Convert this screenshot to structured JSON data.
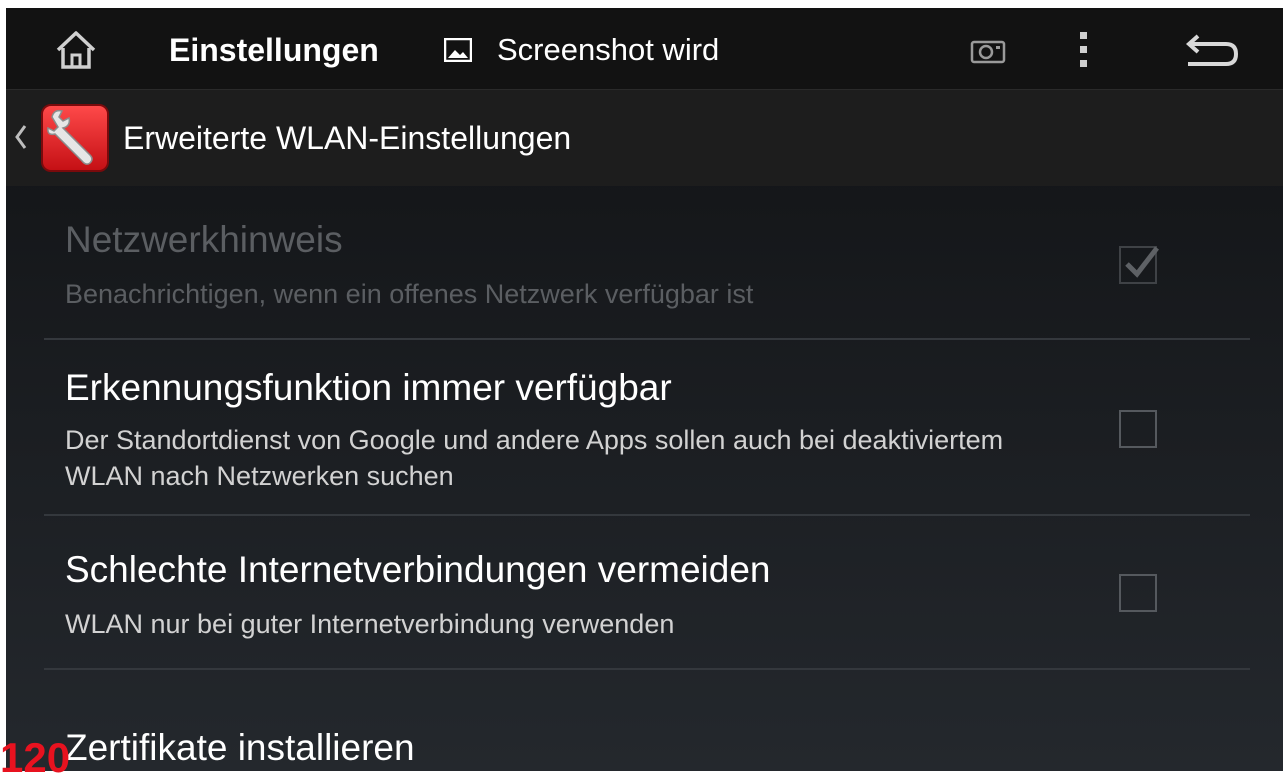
{
  "status_bar": {
    "app_title": "Einstellungen",
    "notification_text": "Screenshot wird",
    "icons": [
      "home-icon",
      "image-icon",
      "camera-icon",
      "overflow-menu-icon",
      "back-icon"
    ]
  },
  "sub_header": {
    "title": "Erweiterte WLAN-Einstellungen",
    "icons": [
      "chevron-left-icon",
      "settings-app-icon"
    ]
  },
  "preferences": [
    {
      "title": "Netzwerkhinweis",
      "summary": "Benachrichtigen, wenn ein offenes Netzwerk verfügbar ist",
      "checked": true,
      "enabled": false
    },
    {
      "title": "Erkennungsfunktion immer verfügbar",
      "summary": "Der Standortdienst von Google und andere Apps sollen auch bei deaktiviertem WLAN nach Netzwerken suchen",
      "checked": false,
      "enabled": true
    },
    {
      "title": "Schlechte Internetverbindungen vermeiden",
      "summary": "WLAN nur bei guter Internetverbindung verwenden",
      "checked": false,
      "enabled": true
    },
    {
      "title": "Zertifikate installieren"
    }
  ],
  "page_number": "120",
  "colors": {
    "accent_red": "#e8121f",
    "background_top": "#0f1011",
    "background_bottom": "#24282d",
    "text_primary": "#ffffff",
    "text_disabled": "#5b5e62"
  }
}
